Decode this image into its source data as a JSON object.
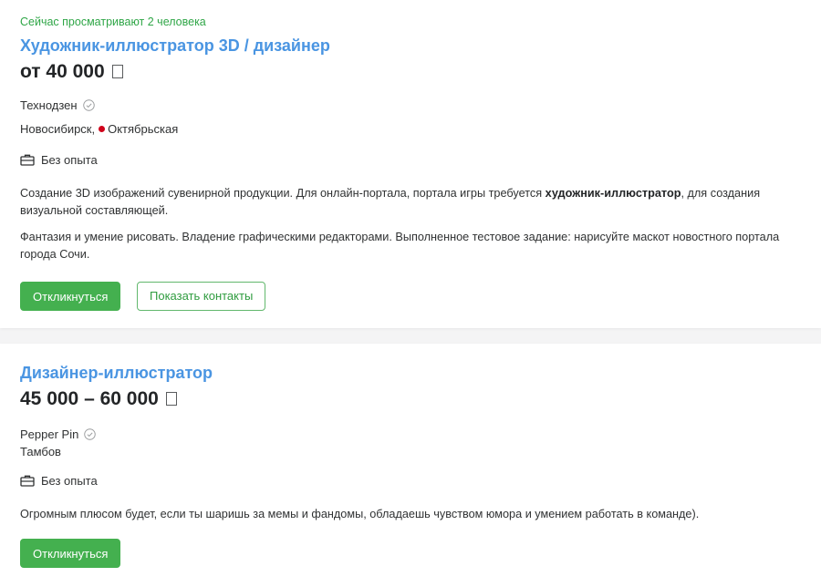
{
  "colors": {
    "title": "#4a95e2",
    "accent_green": "#44b04f",
    "viewers_green": "#2fa647",
    "metro_red": "#d0021b"
  },
  "vacancies": [
    {
      "viewers": "Сейчас просматривают 2 человека",
      "title": "Художник-иллюстратор 3D / дизайнер",
      "salary": "от 40 000",
      "company": "Технодзен",
      "city": "Новосибирск,",
      "metro": "Октябрьская",
      "experience": "Без опыта",
      "description": [
        {
          "before": "Создание 3D изображений сувенирной продукции. Для онлайн-портала, портала игры требуется ",
          "bold": "художник-иллюстратор",
          "after": ", для создания визуальной составляющей."
        },
        {
          "text": "Фантазия и умение рисовать. Владение графическими редакторами. Выполненное тестовое задание: нарисуйте маскот новостного портала города Сочи."
        }
      ],
      "respond_label": "Откликнуться",
      "contacts_label": "Показать контакты"
    },
    {
      "title": "Дизайнер-иллюстратор",
      "salary": "45 000 – 60 000",
      "company": "Pepper Pin",
      "city": "Тамбов",
      "experience": "Без опыта",
      "description": [
        {
          "text": "Огромным плюсом будет, если ты шаришь за мемы и фандомы, обладаешь чувством юмора и умением работать в команде)."
        }
      ],
      "respond_label": "Откликнуться"
    }
  ],
  "icons": {
    "verified": "check-circle-icon",
    "experience": "briefcase-icon"
  }
}
